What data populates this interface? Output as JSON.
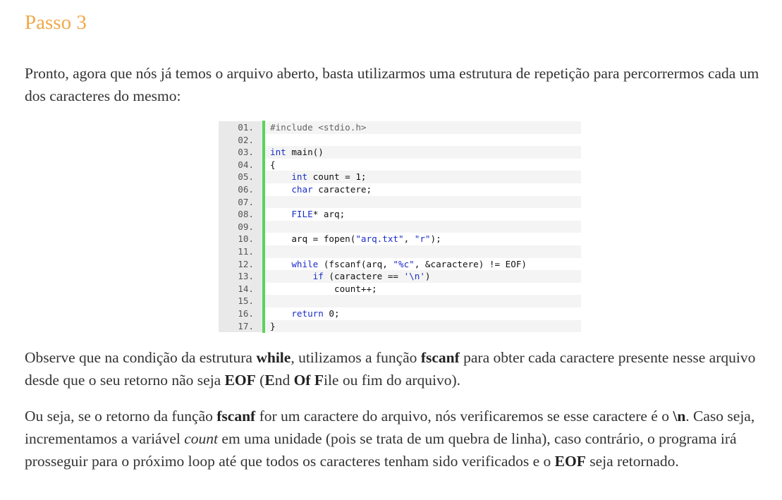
{
  "heading": "Passo 3",
  "p1": "Pronto, agora que nós já temos o arquivo aberto, basta utilizarmos uma estrutura de repetição para percorrermos cada um dos caracteres do mesmo:",
  "p2": {
    "t1": "Observe que na condição da estrutura ",
    "b1": "while",
    "t2": ", utilizamos a função ",
    "b2": "fscanf",
    "t3": " para obter cada caractere presente nesse arquivo desde que o seu retorno não seja ",
    "b3": "EOF",
    "t4": " (",
    "b4": "E",
    "t5": "nd ",
    "b5": "Of",
    "t6": " ",
    "b6": "F",
    "t7": "ile ou fim do arquivo)."
  },
  "p3": {
    "t1": "Ou seja, se o retorno da função ",
    "b1": "fscanf",
    "t2": " for um caractere do arquivo, nós verificaremos se esse caractere é o ",
    "b2": "\\n",
    "t3": ". Caso seja, incrementamos a variável ",
    "i1": "count",
    "t4": " em uma unidade (pois se trata de um quebra de linha), caso contrário, o programa irá prosseguir para o próximo loop até que todos os caracteres tenham sido verificados e o ",
    "b3": "EOF",
    "t5": " seja retornado."
  },
  "code": {
    "lines": [
      {
        "n": "01.",
        "parts": [
          {
            "c": "pre",
            "t": "#include <stdio.h>"
          }
        ]
      },
      {
        "n": "02.",
        "parts": []
      },
      {
        "n": "03.",
        "parts": [
          {
            "c": "kw",
            "t": "int"
          },
          {
            "c": "",
            "t": " main()"
          }
        ]
      },
      {
        "n": "04.",
        "parts": [
          {
            "c": "",
            "t": "{"
          }
        ]
      },
      {
        "n": "05.",
        "parts": [
          {
            "c": "",
            "t": "    "
          },
          {
            "c": "kw",
            "t": "int"
          },
          {
            "c": "",
            "t": " count = 1;"
          }
        ]
      },
      {
        "n": "06.",
        "parts": [
          {
            "c": "",
            "t": "    "
          },
          {
            "c": "kw",
            "t": "char"
          },
          {
            "c": "",
            "t": " caractere;"
          }
        ]
      },
      {
        "n": "07.",
        "parts": []
      },
      {
        "n": "08.",
        "parts": [
          {
            "c": "",
            "t": "    "
          },
          {
            "c": "kw",
            "t": "FILE"
          },
          {
            "c": "",
            "t": "* arq;"
          }
        ]
      },
      {
        "n": "09.",
        "parts": []
      },
      {
        "n": "10.",
        "parts": [
          {
            "c": "",
            "t": "    arq = fopen("
          },
          {
            "c": "str",
            "t": "\"arq.txt\""
          },
          {
            "c": "",
            "t": ", "
          },
          {
            "c": "str",
            "t": "\"r\""
          },
          {
            "c": "",
            "t": ");"
          }
        ]
      },
      {
        "n": "11.",
        "parts": []
      },
      {
        "n": "12.",
        "parts": [
          {
            "c": "",
            "t": "    "
          },
          {
            "c": "kw",
            "t": "while"
          },
          {
            "c": "",
            "t": " (fscanf(arq, "
          },
          {
            "c": "str",
            "t": "\"%c\""
          },
          {
            "c": "",
            "t": ", &caractere) != EOF)"
          }
        ]
      },
      {
        "n": "13.",
        "parts": [
          {
            "c": "",
            "t": "        "
          },
          {
            "c": "kw",
            "t": "if"
          },
          {
            "c": "",
            "t": " (caractere == "
          },
          {
            "c": "str",
            "t": "'\\n'"
          },
          {
            "c": "",
            "t": ")"
          }
        ]
      },
      {
        "n": "14.",
        "parts": [
          {
            "c": "",
            "t": "            count++;"
          }
        ]
      },
      {
        "n": "15.",
        "parts": []
      },
      {
        "n": "16.",
        "parts": [
          {
            "c": "",
            "t": "    "
          },
          {
            "c": "kw",
            "t": "return"
          },
          {
            "c": "",
            "t": " 0;"
          }
        ]
      },
      {
        "n": "17.",
        "parts": [
          {
            "c": "",
            "t": "}"
          }
        ]
      }
    ]
  }
}
